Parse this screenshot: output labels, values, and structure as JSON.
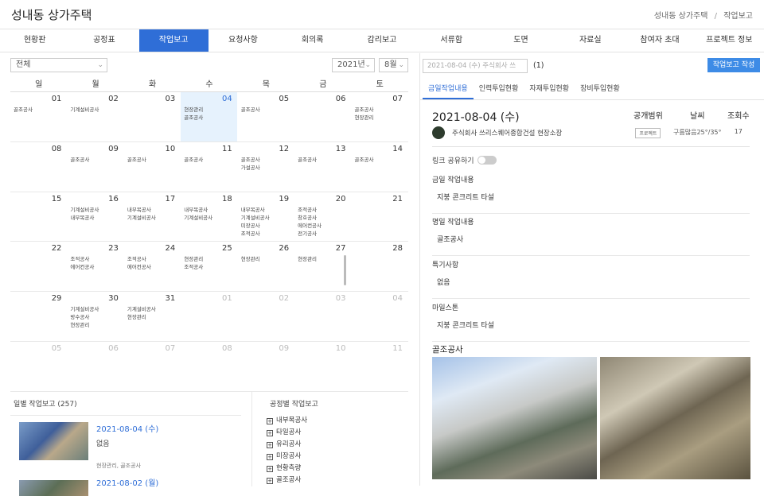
{
  "header": {
    "title": "성내동 상가주택",
    "crumb_project": "성내동 상가주택",
    "crumb_sep": "/",
    "crumb_page": "작업보고"
  },
  "nav": [
    "현황판",
    "공정표",
    "작업보고",
    "요청사항",
    "회의록",
    "감리보고",
    "서류함",
    "도면",
    "자료실",
    "참여자 초대",
    "프로젝트 정보"
  ],
  "calendar": {
    "filter": "전체",
    "year": "2021년",
    "month": "8월",
    "dow": [
      "일",
      "월",
      "화",
      "수",
      "목",
      "금",
      "토"
    ],
    "weeks": [
      [
        {
          "d": "01",
          "e": [
            "골조공사"
          ]
        },
        {
          "d": "02",
          "e": [
            "기계설비공사"
          ]
        },
        {
          "d": "03",
          "e": []
        },
        {
          "d": "04",
          "e": [
            "현장관리",
            "골조공사"
          ],
          "today": true
        },
        {
          "d": "05",
          "e": [
            "골조공사"
          ]
        },
        {
          "d": "06",
          "e": []
        },
        {
          "d": "07",
          "e": [
            "골조공사",
            "현장관리"
          ]
        }
      ],
      [
        {
          "d": "08",
          "e": []
        },
        {
          "d": "09",
          "e": [
            "골조공사"
          ]
        },
        {
          "d": "10",
          "e": [
            "골조공사"
          ]
        },
        {
          "d": "11",
          "e": [
            "골조공사"
          ]
        },
        {
          "d": "12",
          "e": [
            "골조공사",
            "가설공사"
          ]
        },
        {
          "d": "13",
          "e": [
            "골조공사"
          ]
        },
        {
          "d": "14",
          "e": [
            "골조공사"
          ]
        }
      ],
      [
        {
          "d": "15",
          "e": []
        },
        {
          "d": "16",
          "e": [
            "기계설비공사",
            "내부목공사"
          ]
        },
        {
          "d": "17",
          "e": [
            "내부목공사",
            "기계설비공사"
          ]
        },
        {
          "d": "18",
          "e": [
            "내부목공사",
            "기계설비공사"
          ]
        },
        {
          "d": "19",
          "e": [
            "내부목공사",
            "기계설비공사",
            "미장공사",
            "조적공사"
          ]
        },
        {
          "d": "20",
          "e": [
            "조적공사",
            "창호공사",
            "에어컨공사",
            "전기공사"
          ]
        },
        {
          "d": "21",
          "e": []
        }
      ],
      [
        {
          "d": "22",
          "e": []
        },
        {
          "d": "23",
          "e": [
            "조적공사",
            "에어컨공사"
          ]
        },
        {
          "d": "24",
          "e": [
            "조적공사",
            "에어컨공사"
          ]
        },
        {
          "d": "25",
          "e": [
            "현장관리",
            "조적공사"
          ]
        },
        {
          "d": "26",
          "e": [
            "현장관리"
          ]
        },
        {
          "d": "27",
          "e": [
            "현장관리"
          ]
        },
        {
          "d": "28",
          "e": []
        }
      ],
      [
        {
          "d": "29",
          "e": []
        },
        {
          "d": "30",
          "e": [
            "기계설비공사",
            "방수공사",
            "현장관리"
          ]
        },
        {
          "d": "31",
          "e": [
            "기계설비공사",
            "현장관리"
          ]
        },
        {
          "d": "01",
          "e": [],
          "muted": true
        },
        {
          "d": "02",
          "e": [],
          "muted": true
        },
        {
          "d": "03",
          "e": [],
          "muted": true
        },
        {
          "d": "04",
          "e": [],
          "muted": true
        }
      ],
      [
        {
          "d": "05",
          "e": [],
          "muted": true
        },
        {
          "d": "06",
          "e": [],
          "muted": true
        },
        {
          "d": "07",
          "e": [],
          "muted": true
        },
        {
          "d": "08",
          "e": [],
          "muted": true
        },
        {
          "d": "09",
          "e": [],
          "muted": true
        },
        {
          "d": "10",
          "e": [],
          "muted": true
        },
        {
          "d": "11",
          "e": [],
          "muted": true
        }
      ]
    ]
  },
  "daily": {
    "title": "일별 작업보고 (257)",
    "items": [
      {
        "date": "2021-08-04 (수)",
        "note": "없음",
        "tags": "현장관리, 골조공사"
      },
      {
        "date": "2021-08-02 (월)"
      }
    ]
  },
  "process": {
    "title": "공정별 작업보고",
    "items": [
      "내부목공사",
      "타일공사",
      "유리공사",
      "미장공사",
      "현황측량",
      "골조공사"
    ]
  },
  "report": {
    "select": "2021-08-04 (수) 주식회사 쓰",
    "count": "(1)",
    "write_button": "작업보고 작성",
    "tabs": [
      "금일작업내용",
      "인력투입현황",
      "자재투입현황",
      "장비투입현황"
    ],
    "date": "2021-08-04 (수)",
    "author": "주식회사 쓰리스퀘어종합건설 현장소장",
    "meta_labels": {
      "visibility": "공개범위",
      "weather": "날씨",
      "views": "조회수"
    },
    "visibility": "프로젝트",
    "weather": "구름많음25°/35°",
    "views": "17",
    "share_label": "링크 공유하기",
    "sections": [
      {
        "title": "금일 작업내용",
        "body": "지붕 콘크리트 타설"
      },
      {
        "title": "명일 작업내용",
        "body": "골조공사"
      },
      {
        "title": "특기사항",
        "body": "없음"
      },
      {
        "title": "마일스톤",
        "body": "지붕 콘크리트 타설"
      }
    ],
    "photo_title": "골조공사"
  },
  "colors": {
    "accent": "#2f6ed7",
    "button": "#3d8be6",
    "today_bg": "#e6f2fd"
  }
}
